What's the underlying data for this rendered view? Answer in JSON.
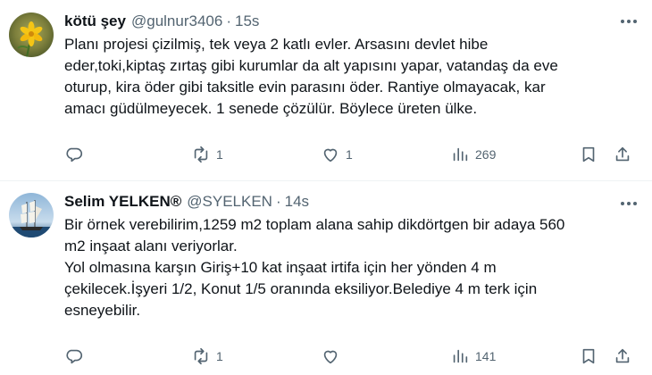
{
  "tweets": [
    {
      "author": "kötü şey",
      "handle": "@gulnur3406",
      "dot": "·",
      "time": "15s",
      "lines": [
        "Planı projesi çizilmiş, tek veya 2 katlı evler. Arsasını devlet hibe",
        "eder,toki,kiptaş zırtaş gibi kurumlar da alt yapısını yapar, vatandaş da eve",
        "oturup, kira öder gibi taksitle evin parasını öder. Rantiye olmayacak, kar",
        "amacı güdülmeyecek. 1 senede çözülür. Böylece üreten ülke."
      ],
      "replies": "",
      "retweets": "1",
      "likes": "1",
      "views": "269",
      "avatar": "yellow-flower-avatar"
    },
    {
      "author": "Selim YELKEN®",
      "handle": "@SYELKEN",
      "dot": "·",
      "time": "14s",
      "lines": [
        "Bir örnek verebilirim,1259 m2 toplam alana sahip dikdörtgen bir adaya 560",
        "m2 inşaat alanı veriyorlar.",
        "Yol olmasına karşın Giriş+10 kat inşaat irtifa için her yönden 4 m",
        "çekilecek.İşyeri 1/2, Konut 1/5 oranında eksiliyor.Belediye 4 m terk için",
        "esneyebilir."
      ],
      "replies": "",
      "retweets": "1",
      "likes": "",
      "views": "141",
      "avatar": "sailing-ship-avatar"
    }
  ],
  "colors": {
    "text": "#0f1419",
    "secondary": "#536471",
    "divider": "#eff3f4"
  },
  "icons": {
    "reply": "reply-icon",
    "retweet": "retweet-icon",
    "like": "heart-icon",
    "views": "views-icon",
    "bookmark": "bookmark-icon",
    "share": "share-icon",
    "more": "more-icon"
  }
}
